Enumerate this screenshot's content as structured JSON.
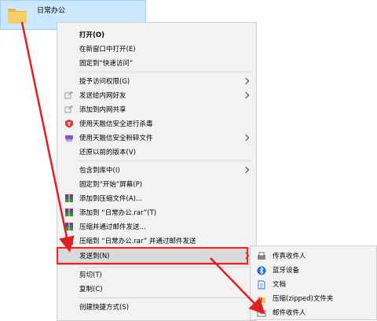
{
  "folder": {
    "name": "日常办公"
  },
  "context_menu": {
    "open": "打开(O)",
    "open_new_window": "在新窗口中打开(E)",
    "pin_quick_access": "固定到“快速访问”",
    "grant_access": "授予访问权限(G)",
    "send_intranet_friend": "发送给内网好友",
    "add_intranet_share": "添加到内网共享",
    "scan_virus": "使用天融信安全进行杀毒",
    "shred_file": "使用天融信安全粉碎文件",
    "restore_previous": "还原以前的版本(V)",
    "include_library": "包含到库中(I)",
    "pin_start": "固定到“开始”屏幕(P)",
    "add_archive": "添加到压缩文件(A)...",
    "add_rar": "添加到 “日常办公.rar”(T)",
    "compress_email": "压缩并通过邮件发送...",
    "compress_rar_email": "压缩到 “日常办公.rar” 并通过邮件发送",
    "send_to": "发送到(N)",
    "cut": "剪切(T)",
    "copy": "复制(C)",
    "create_shortcut": "创建快捷方式(S)"
  },
  "send_to_menu": {
    "fax": "传真收件人",
    "bluetooth": "蓝牙设备",
    "documents": "文档",
    "zip": "压缩(zipped)文件夹",
    "mail": "邮件收件人"
  },
  "colors": {
    "annotation_red": "#e02020",
    "selection_bg": "#cce8ff",
    "menu_bg": "#f2f2f2"
  }
}
